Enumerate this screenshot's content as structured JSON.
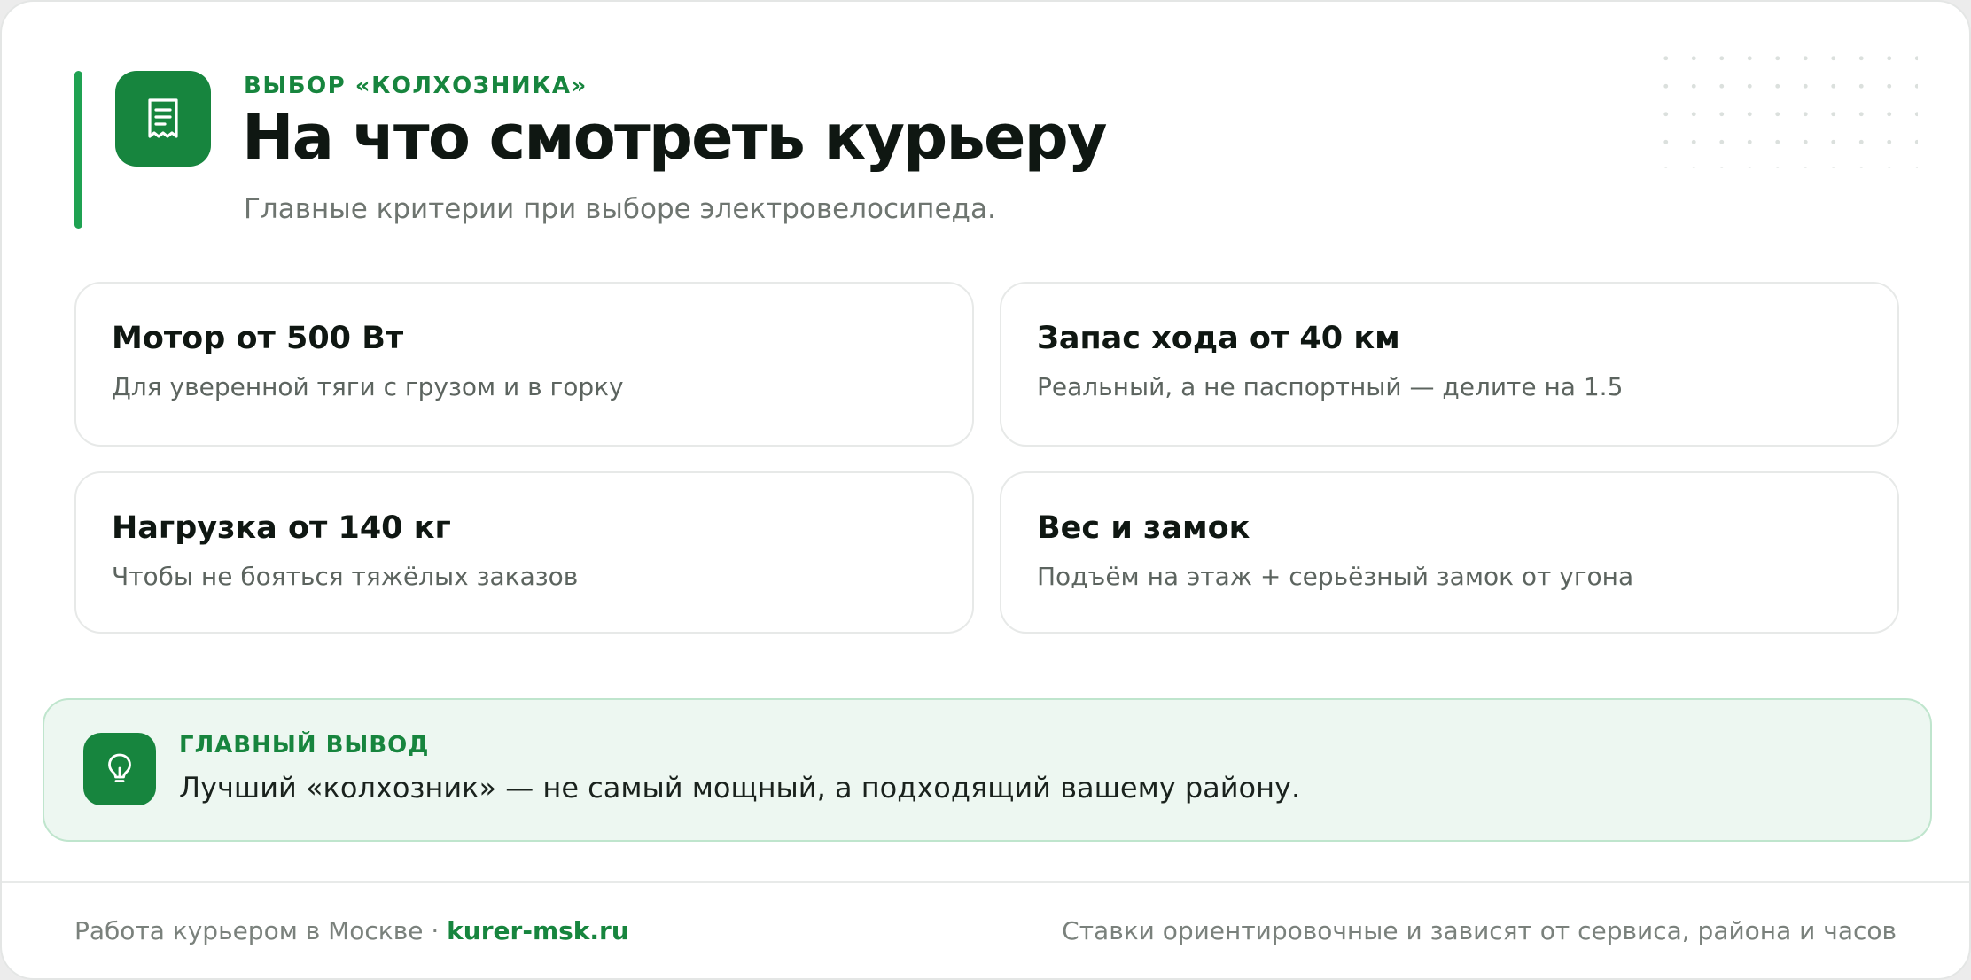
{
  "header": {
    "eyebrow": "ВЫБОР «КОЛХОЗНИКА»",
    "title": "На что смотреть курьеру",
    "subtitle": "Главные критерии при выборе электровелосипеда.",
    "icon": "receipt-icon"
  },
  "criteria": [
    {
      "title": "Мотор от 500 Вт",
      "description": "Для уверенной тяги с грузом и в горку"
    },
    {
      "title": "Запас хода от 40 км",
      "description": "Реальный, а не паспортный — делите на 1.5"
    },
    {
      "title": "Нагрузка от 140 кг",
      "description": "Чтобы не бояться тяжёлых заказов"
    },
    {
      "title": "Вес и замок",
      "description": "Подъём на этаж + серьёзный замок от угона"
    }
  ],
  "conclusion": {
    "icon": "lightbulb-icon",
    "label": "ГЛАВНЫЙ ВЫВОД",
    "text": "Лучший «колхозник» — не самый мощный, а подходящий вашему району."
  },
  "footer": {
    "left_text": "Работа курьером в Москве · ",
    "site": "kurer-msk.ru",
    "right_text": "Ставки ориентировочные и зависят от сервиса, района и часов"
  },
  "colors": {
    "accent": "#17853e",
    "accent_bar": "#1fa252",
    "conclusion_bg": "#edf7f1",
    "conclusion_border": "#bfe5cd"
  }
}
